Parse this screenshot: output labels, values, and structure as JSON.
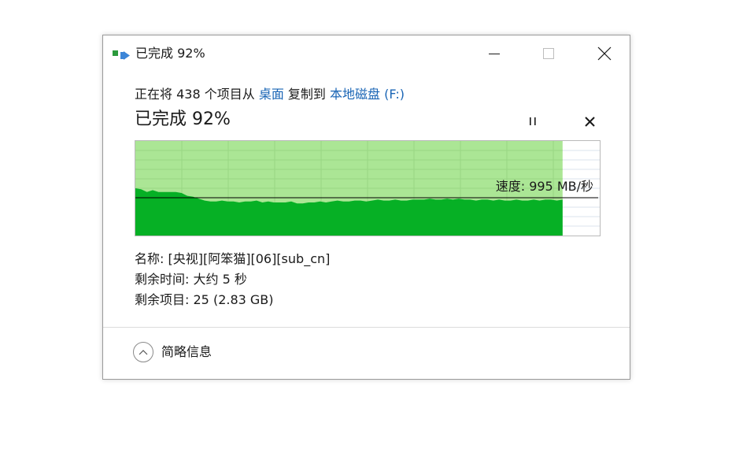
{
  "window": {
    "title": "已完成 92%",
    "controls": {
      "minimize_icon": "minimize-icon",
      "maximize_icon": "maximize-icon",
      "close_icon": "close-icon"
    }
  },
  "copy": {
    "prefix": "正在将 438 个项目从",
    "source": "桌面",
    "middle": "复制到",
    "destination": "本地磁盘 (F:)",
    "heading": "已完成 92%",
    "progress_fraction": 0.92
  },
  "buttons": {
    "pause_icon": "pause-icon",
    "cancel_icon": "cancel-icon"
  },
  "chart_data": {
    "type": "area",
    "completion_fraction": 0.92,
    "speed_label": "速度: 995 MB/秒",
    "current_speed_fraction": 0.4,
    "speed_profile": [
      0.5,
      0.49,
      0.46,
      0.48,
      0.46,
      0.46,
      0.46,
      0.46,
      0.45,
      0.42,
      0.41,
      0.39,
      0.37,
      0.36,
      0.36,
      0.37,
      0.36,
      0.36,
      0.35,
      0.36,
      0.36,
      0.37,
      0.35,
      0.36,
      0.35,
      0.35,
      0.35,
      0.36,
      0.34,
      0.34,
      0.35,
      0.35,
      0.36,
      0.35,
      0.36,
      0.37,
      0.36,
      0.36,
      0.37,
      0.37,
      0.36,
      0.37,
      0.38,
      0.37,
      0.37,
      0.38,
      0.37,
      0.37,
      0.38,
      0.38,
      0.38,
      0.39,
      0.38,
      0.38,
      0.39,
      0.38,
      0.39,
      0.38,
      0.38,
      0.37,
      0.38,
      0.38,
      0.37,
      0.38,
      0.37,
      0.37,
      0.38,
      0.37,
      0.37,
      0.38,
      0.37,
      0.38,
      0.38,
      0.37,
      0.38
    ],
    "colors": {
      "completed_bg": "#abe695",
      "grid": "#98d684",
      "fill": "#06b025",
      "speed_line": "#000000",
      "remaining_grid": "#dbe3ec"
    },
    "grid": true
  },
  "details": {
    "name_label": "名称:",
    "name_value": "[央视][阿笨猫][06][sub_cn]",
    "time_label": "剩余时间:",
    "time_value": "大约 5 秒",
    "items_label": "剩余项目:",
    "items_value": "25 (2.83 GB)"
  },
  "footer": {
    "toggle_label": "简略信息",
    "toggle_icon": "chevron-up-icon"
  }
}
